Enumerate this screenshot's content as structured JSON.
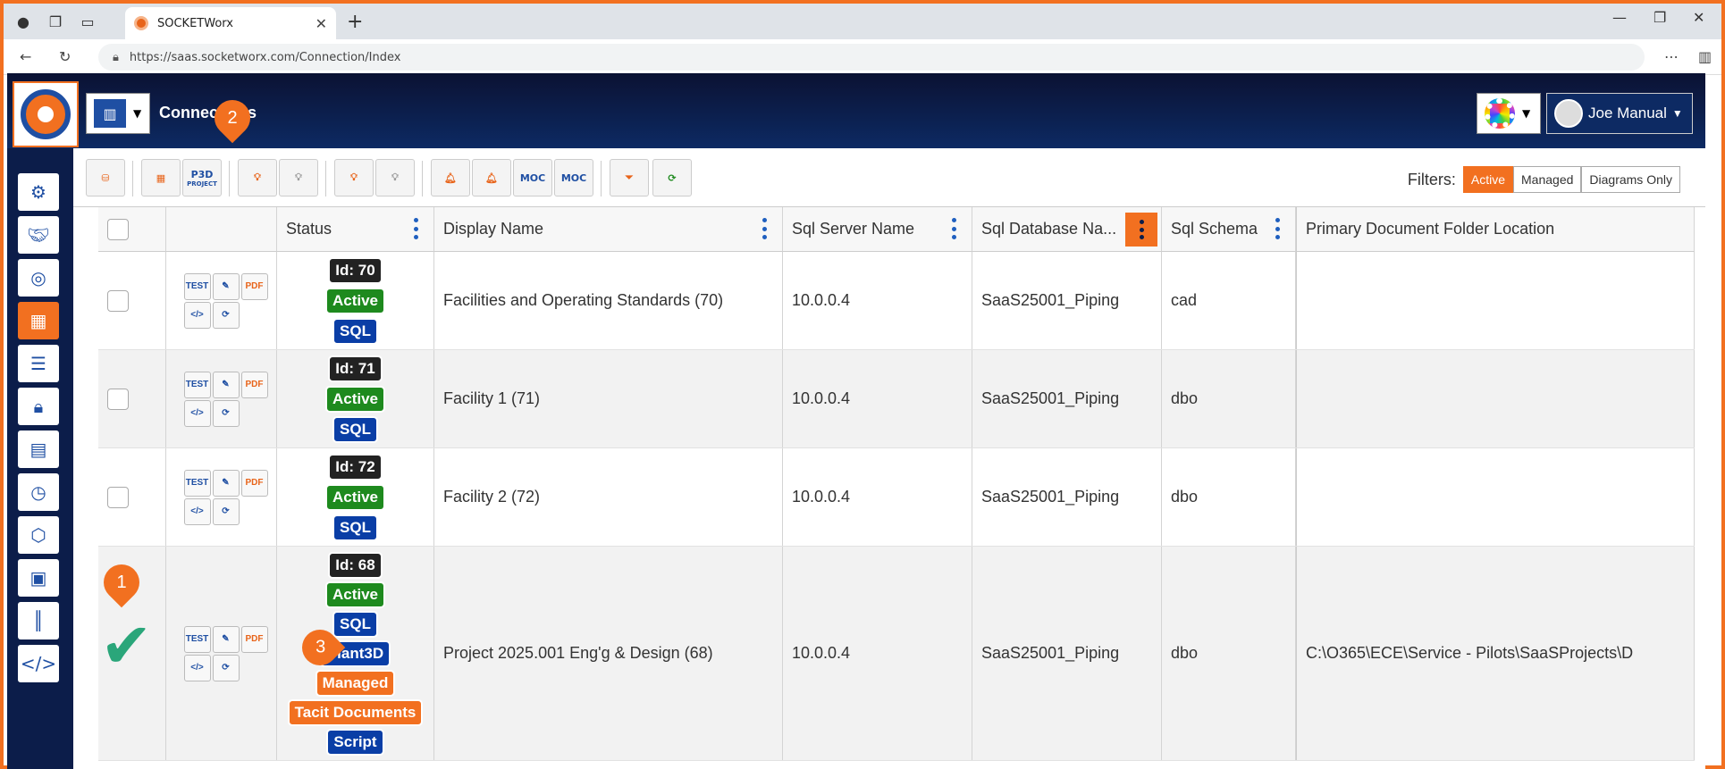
{
  "browser": {
    "tab_title": "SOCKETWorx",
    "url": "https://saas.socketworx.com/Connection/Index"
  },
  "header": {
    "page_title": "Connections",
    "user_name": "Joe Manual"
  },
  "toolbar": {
    "p3d_label": "P3D",
    "p3d_sub": "PROJECT",
    "moc_label": "MOC",
    "filters_label": "Filters:",
    "filter_buttons": [
      "Active",
      "Managed",
      "Diagrams Only"
    ],
    "active_filter": "Active"
  },
  "grid": {
    "columns": [
      "Status",
      "Display Name",
      "Sql Server Name",
      "Sql Database Na...",
      "Sql Schema",
      "Primary Document Folder Location"
    ],
    "row_actions": [
      "TEST",
      "edit",
      "PDF SETUP",
      "</>",
      "sync"
    ],
    "rows": [
      {
        "badges": [
          "Id: 70",
          "Active",
          "SQL"
        ],
        "display_name": "Facilities and Operating Standards (70)",
        "server": "10.0.0.4",
        "database": "SaaS25001_Piping",
        "schema": "cad",
        "folder": ""
      },
      {
        "badges": [
          "Id: 71",
          "Active",
          "SQL"
        ],
        "display_name": "Facility 1 (71)",
        "server": "10.0.0.4",
        "database": "SaaS25001_Piping",
        "schema": "dbo",
        "folder": ""
      },
      {
        "badges": [
          "Id: 72",
          "Active",
          "SQL"
        ],
        "display_name": "Facility 2 (72)",
        "server": "10.0.0.4",
        "database": "SaaS25001_Piping",
        "schema": "dbo",
        "folder": ""
      },
      {
        "badges": [
          "Id: 68",
          "Active",
          "SQL",
          "Plant3D",
          "Managed",
          "Tacit Documents",
          "Script"
        ],
        "display_name": "Project 2025.001 Eng'g & Design (68)",
        "server": "10.0.0.4",
        "database": "SaaS25001_Piping",
        "schema": "dbo",
        "folder": "C:\\O365\\ECE\\Service - Pilots\\SaaSProjects\\D"
      }
    ]
  },
  "callouts": [
    "1",
    "2",
    "3"
  ],
  "colors": {
    "accent": "#f27020",
    "navy": "#0c1d4a",
    "green": "#1e8a1e",
    "blue": "#0a3ea6"
  }
}
